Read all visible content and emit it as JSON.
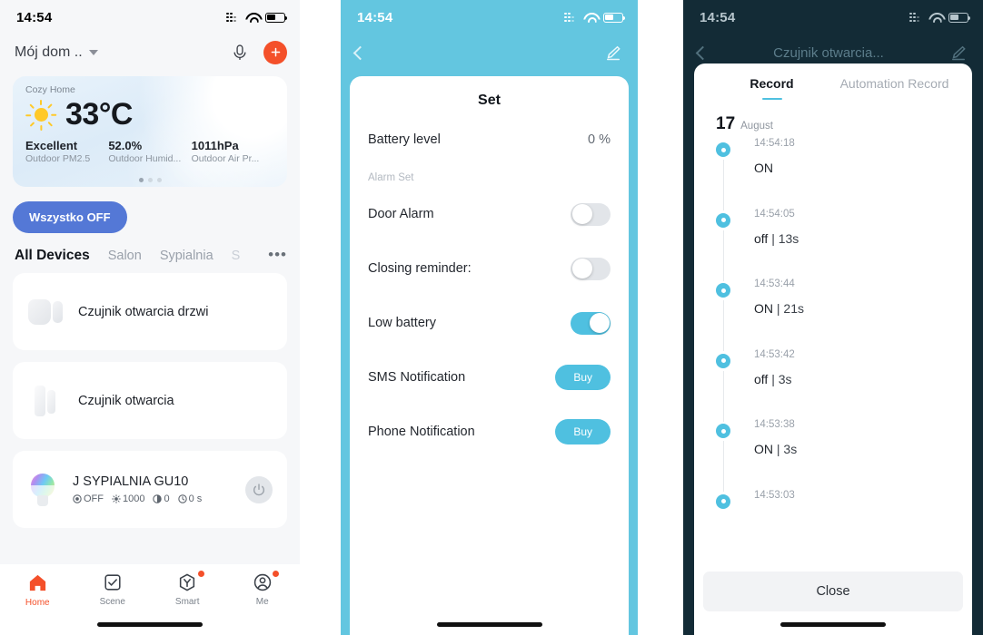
{
  "panels": {
    "home": {
      "status": {
        "time": "14:54"
      },
      "header": {
        "title": "Mój dom ..",
        "mic_icon": "microphone-icon",
        "add_icon": "plus-icon"
      },
      "weather": {
        "home_name": "Cozy Home",
        "weather_icon": "sun-icon",
        "temperature": "33°C",
        "stats": [
          {
            "value": "Excellent",
            "label": "Outdoor PM2.5"
          },
          {
            "value": "52.0%",
            "label": "Outdoor Humid..."
          },
          {
            "value": "1011hPa",
            "label": "Outdoor Air Pr..."
          }
        ]
      },
      "all_off_button": "Wszystko OFF",
      "tabs": [
        {
          "label": "All Devices",
          "active": true
        },
        {
          "label": "Salon",
          "active": false
        },
        {
          "label": "Sypialnia",
          "active": false
        },
        {
          "label": "S",
          "active": false
        }
      ],
      "tabs_more": "•••",
      "devices": [
        {
          "name": "Czujnik otwarcia drzwi",
          "icon": "door-sensor-icon",
          "sub": []
        },
        {
          "name": "Czujnik otwarcia",
          "icon": "window-sensor-icon",
          "sub": []
        },
        {
          "name": "J SYPIALNIA GU10",
          "icon": "color-bulb-icon",
          "power_icon": "power-icon",
          "sub": [
            {
              "icon": "mode-icon",
              "text": "OFF"
            },
            {
              "icon": "brightness-icon",
              "text": "1000"
            },
            {
              "icon": "temperature-icon",
              "text": "0"
            },
            {
              "icon": "timer-icon",
              "text": "0 s"
            }
          ]
        }
      ],
      "tabbar": [
        {
          "label": "Home",
          "icon": "home-icon",
          "active": true,
          "badge": false
        },
        {
          "label": "Scene",
          "icon": "scene-check-icon",
          "active": false,
          "badge": false
        },
        {
          "label": "Smart",
          "icon": "smart-icon",
          "active": false,
          "badge": true
        },
        {
          "label": "Me",
          "icon": "profile-icon",
          "active": false,
          "badge": true
        }
      ]
    },
    "set": {
      "status": {
        "time": "14:54"
      },
      "nav": {
        "back_icon": "chevron-left-icon",
        "edit_icon": "pencil-icon"
      },
      "title": "Set",
      "rows": [
        {
          "kind": "value",
          "label": "Battery level",
          "value": "0 %"
        },
        {
          "kind": "section",
          "label": "Alarm Set"
        },
        {
          "kind": "toggle",
          "label": "Door Alarm",
          "on": false
        },
        {
          "kind": "toggle",
          "label": "Closing reminder:",
          "on": false
        },
        {
          "kind": "toggle",
          "label": "Low battery",
          "on": true
        },
        {
          "kind": "buy",
          "label": "SMS Notification",
          "button": "Buy"
        },
        {
          "kind": "buy",
          "label": "Phone Notification",
          "button": "Buy"
        }
      ]
    },
    "record": {
      "status": {
        "time": "14:54"
      },
      "nav": {
        "back_icon": "chevron-left-icon",
        "title": "Czujnik otwarcia...",
        "edit_icon": "pencil-icon"
      },
      "tabs": [
        {
          "label": "Record",
          "active": true
        },
        {
          "label": "Automation Record",
          "active": false
        }
      ],
      "date": {
        "day": "17",
        "month": "August"
      },
      "entries": [
        {
          "time": "14:54:18",
          "state": "ON",
          "duration": ""
        },
        {
          "time": "14:54:05",
          "state": "off",
          "duration": "| 13s"
        },
        {
          "time": "14:53:44",
          "state": "ON",
          "duration": "| 21s"
        },
        {
          "time": "14:53:42",
          "state": "off",
          "duration": "| 3s"
        },
        {
          "time": "14:53:38",
          "state": "ON",
          "duration": "| 3s"
        },
        {
          "time": "14:53:03",
          "state": "",
          "duration": ""
        }
      ],
      "close_button": "Close"
    }
  },
  "colors": {
    "accent_orange": "#f4502a",
    "accent_blue": "#5478d6",
    "cyan": "#4fc0e0",
    "panel_cyan_bg": "#63c6e0",
    "dim_overlay": "#132b36"
  }
}
